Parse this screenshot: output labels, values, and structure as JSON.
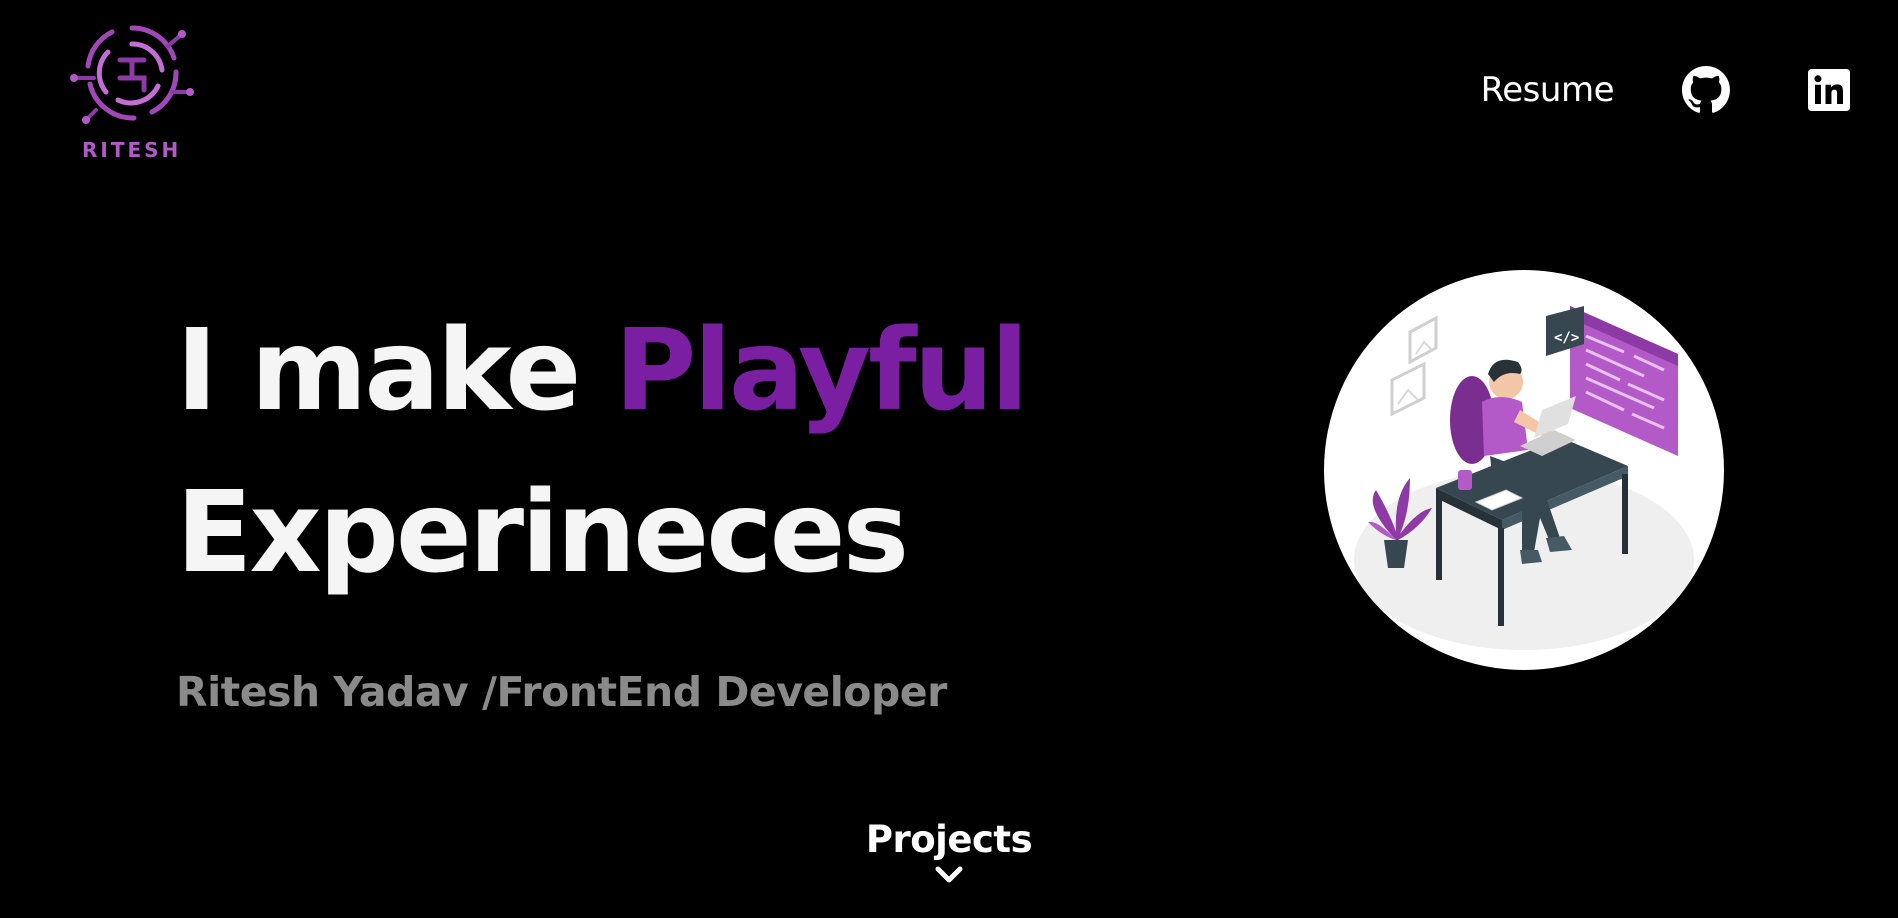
{
  "brand": {
    "name": "RITESH",
    "logo_icon": "circuit-logo-icon",
    "color": "#b45ac8"
  },
  "nav": {
    "resume_label": "Resume",
    "github_icon": "github-icon",
    "linkedin_icon": "linkedin-icon"
  },
  "hero": {
    "line1_prefix": "I make ",
    "line1_accent": "Playful",
    "line2": "Experineces",
    "subtitle": "Ritesh Yadav /FrontEnd Developer",
    "accent_color": "#7a1fa2",
    "illustration_icon": "developer-at-desk-illustration"
  },
  "projects": {
    "label": "Projects",
    "icon": "chevron-down-icon"
  },
  "colors": {
    "background": "#000000",
    "text": "#f5f5f5",
    "subtitle": "#8a8a8a"
  }
}
